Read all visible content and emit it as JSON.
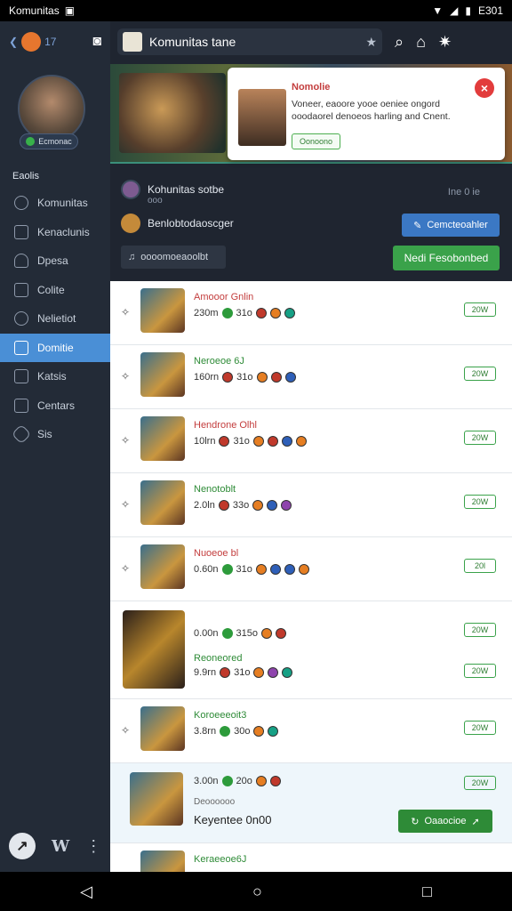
{
  "status_bar": {
    "app_name": "Komunitas",
    "time": "E301"
  },
  "sidebar": {
    "back_count": "17",
    "avatar_badge": "Ecmonac",
    "heading": "Eaolis",
    "items": [
      {
        "label": "Komunitas",
        "icon": "globe-icon"
      },
      {
        "label": "Kenaclunis",
        "icon": "note-icon"
      },
      {
        "label": "Dpesa",
        "icon": "hat-icon"
      },
      {
        "label": "Colite",
        "icon": "edit-icon"
      },
      {
        "label": "Nelietiot",
        "icon": "paw-icon"
      },
      {
        "label": "Domitie",
        "icon": "grid-icon",
        "active": true
      },
      {
        "label": "Katsis",
        "icon": "box-icon"
      },
      {
        "label": "Centars",
        "icon": "phone-icon"
      },
      {
        "label": "Sis",
        "icon": "link-icon"
      }
    ]
  },
  "topbar": {
    "title": "Komunitas tane"
  },
  "popup": {
    "title": "Nomolie",
    "body": "Voneer, eaoore yooe oeniee ongord ooodaorel denoeos harling and Cnent.",
    "button": "Oonoono"
  },
  "community": {
    "name": "Kohunitas sotbe",
    "sub": "ooo",
    "meta": "Ine  0 ie",
    "row2": "Benlobtodaoscger",
    "blue_button": "Cemcteoahler",
    "filter": "oooomoeaoolbt",
    "green_button": "Nedi Fesobonbed"
  },
  "list": [
    {
      "name": "Amooor Gnlin",
      "stats": "230m",
      "score": "31o",
      "tag": "20W",
      "red": true
    },
    {
      "name": "Neroeoe 6J",
      "stats": "160rn",
      "score": "31o",
      "tag": "20W"
    },
    {
      "name": "Hendrone Olhl",
      "stats": "10lrn",
      "score": "31o",
      "tag": "20W",
      "red": true
    },
    {
      "name": "Nenotoblt",
      "stats": "2.0ln",
      "score": "33o",
      "tag": "20W"
    },
    {
      "name": "Nuoeoe bl",
      "stats": "0.60n",
      "score": "31o",
      "tag": "20l",
      "red": true
    }
  ],
  "tall_row": {
    "stats_a": "0.00n",
    "score_a": "315o",
    "tag_a": "20W",
    "name_b": "Reoneored",
    "stats_b": "9.9rn",
    "score_b": "31o",
    "tag_b": "20W"
  },
  "row8": {
    "name": "Koroeeeoit3",
    "stats": "3.8rn",
    "score": "30o",
    "tag": "20W"
  },
  "highlight_row": {
    "stats": "3.00n",
    "score": "20o",
    "sub": "Deoooooo",
    "detail": "Keyentee 0n00",
    "tag": "20W",
    "button": "Oaaocioe"
  },
  "last_row": {
    "name": "Keraeeoe6J"
  }
}
